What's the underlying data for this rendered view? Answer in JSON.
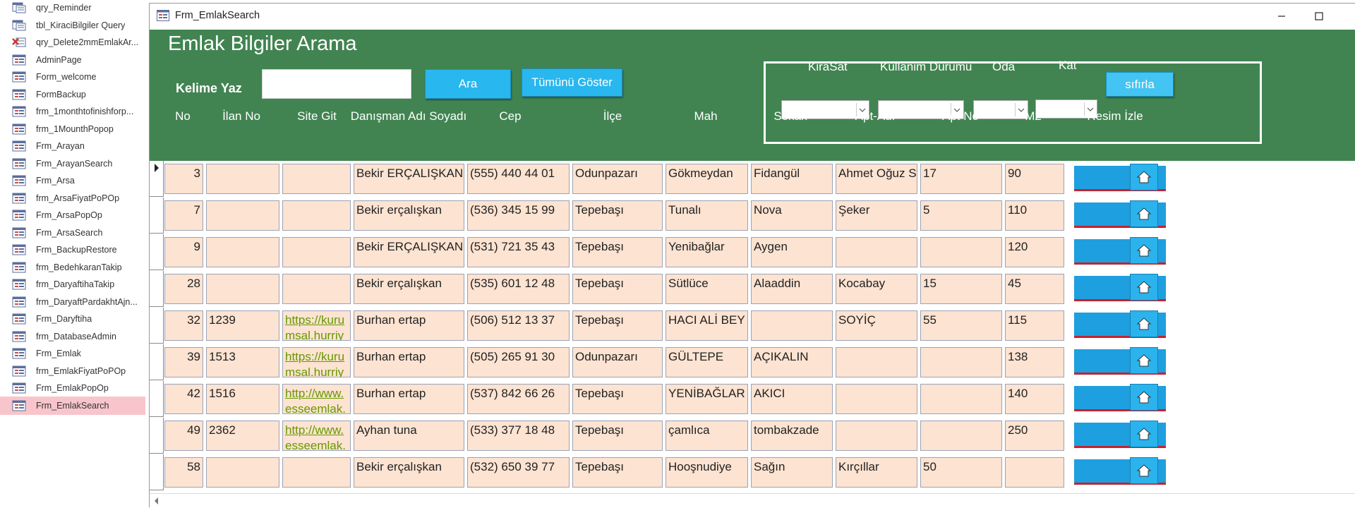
{
  "nav": {
    "items": [
      {
        "label": "qry_Reminder",
        "icon": "query-icon"
      },
      {
        "label": "tbl_KiraciBilgiler Query",
        "icon": "query-icon"
      },
      {
        "label": "qry_Delete2mmEmlakAr...",
        "icon": "delete-query-icon"
      },
      {
        "label": "AdminPage",
        "icon": "form-icon"
      },
      {
        "label": "Form_welcome",
        "icon": "form-icon"
      },
      {
        "label": "FormBackup",
        "icon": "form-icon"
      },
      {
        "label": "frm_1monthtofinishforp...",
        "icon": "form-icon"
      },
      {
        "label": "frm_1MounthPopop",
        "icon": "form-icon"
      },
      {
        "label": "Frm_Arayan",
        "icon": "form-icon"
      },
      {
        "label": "Frm_ArayanSearch",
        "icon": "form-icon"
      },
      {
        "label": "Frm_Arsa",
        "icon": "form-icon"
      },
      {
        "label": "frm_ArsaFiyatPoPOp",
        "icon": "form-icon"
      },
      {
        "label": "Frm_ArsaPopOp",
        "icon": "form-icon"
      },
      {
        "label": "Frm_ArsaSearch",
        "icon": "form-icon"
      },
      {
        "label": "Frm_BackupRestore",
        "icon": "form-icon"
      },
      {
        "label": "frm_BedehkaranTakip",
        "icon": "form-icon"
      },
      {
        "label": "frm_DaryaftihaTakip",
        "icon": "form-icon"
      },
      {
        "label": "frm_DaryaftPardakhtAjn...",
        "icon": "form-icon"
      },
      {
        "label": "Frm_Daryftiha",
        "icon": "form-icon"
      },
      {
        "label": "frm_DatabaseAdmin",
        "icon": "form-icon"
      },
      {
        "label": "Frm_Emlak",
        "icon": "form-icon"
      },
      {
        "label": "frm_EmlakFiyatPoPOp",
        "icon": "form-icon"
      },
      {
        "label": "Frm_EmlakPopOp",
        "icon": "form-icon"
      },
      {
        "label": "Frm_EmlakSearch",
        "icon": "form-icon",
        "selected": true
      }
    ]
  },
  "window": {
    "title": "Frm_EmlakSearch"
  },
  "header": {
    "title": "Emlak Bilgiler Arama",
    "keyword_label": "Kelime Yaz",
    "keyword_value": "",
    "search_button": "Ara",
    "show_all_button": "Tümünü Göster",
    "filters": {
      "kirasat_label": "KiraSat",
      "kullanim_label": "Kullanim Durumu",
      "oda_label": "Oda",
      "kat_label": "Kat",
      "reset_button": "sıfırla"
    }
  },
  "columns": [
    "No",
    "İlan No",
    "Site Git",
    "Danışman Adı Soyadı",
    "Cep",
    "İlçe",
    "Mah",
    "Sokak",
    "Apt-Adı",
    "Apt No",
    "M2",
    "Resim İzle"
  ],
  "rows": [
    {
      "no": "3",
      "ilan": "",
      "site": "",
      "danisman": "Bekir ERÇALIŞKAN",
      "cep": "(555) 440 44 01",
      "ilce": "Odunpazarı",
      "mah": "Gökmeydan",
      "sokak": "Fidangül",
      "apt": "Ahmet Oğuz St.",
      "aptno": "17",
      "m2": "90",
      "current": true
    },
    {
      "no": "7",
      "ilan": "",
      "site": "",
      "danisman": "Bekir erçalışkan",
      "cep": "(536) 345 15 99",
      "ilce": "Tepebaşı",
      "mah": "Tunalı",
      "sokak": "Nova",
      "apt": "Şeker",
      "aptno": "5",
      "m2": "110"
    },
    {
      "no": "9",
      "ilan": "",
      "site": "",
      "danisman": "Bekir ERÇALIŞKAN",
      "cep": "(531) 721 35 43",
      "ilce": "Tepebaşı",
      "mah": "Yenibağlar",
      "sokak": "Aygen",
      "apt": "",
      "aptno": "",
      "m2": "120"
    },
    {
      "no": "28",
      "ilan": "",
      "site": "",
      "danisman": "Bekir erçalışkan",
      "cep": "(535) 601 12 48",
      "ilce": "Tepebaşı",
      "mah": "Sütlüce",
      "sokak": "Alaaddin",
      "apt": "Kocabay",
      "aptno": "15",
      "m2": "45"
    },
    {
      "no": "32",
      "ilan": "1239",
      "site": "https://kurumsal.hurriyeteml",
      "danisman": "Burhan ertap",
      "cep": "(506) 512 13 37",
      "ilce": "Tepebaşı",
      "mah": "HACI ALİ BEY",
      "sokak": "",
      "apt": "SOYİÇ",
      "aptno": "55",
      "m2": "115"
    },
    {
      "no": "39",
      "ilan": "1513",
      "site": "https://kurumsal.hurriyeteml",
      "danisman": "Burhan ertap",
      "cep": "(505) 265 91 30",
      "ilce": "Odunpazarı",
      "mah": "GÜLTEPE",
      "sokak": "AÇIKALIN",
      "apt": "",
      "aptno": "",
      "m2": "138"
    },
    {
      "no": "42",
      "ilan": "1516",
      "site": "http://www.esseemlak.com/",
      "danisman": "Burhan ertap",
      "cep": "(537) 842 66 26",
      "ilce": "Tepebaşı",
      "mah": "YENİBAĞLAR",
      "sokak": "AKICI",
      "apt": "",
      "aptno": "",
      "m2": "140"
    },
    {
      "no": "49",
      "ilan": "2362",
      "site": "http://www.esseemlak.com/i",
      "danisman": "Ayhan tuna",
      "cep": "(533) 377 18 48",
      "ilce": "Tepebaşı",
      "mah": "çamlıca",
      "sokak": "tombakzade",
      "apt": "",
      "aptno": "",
      "m2": "250"
    },
    {
      "no": "58",
      "ilan": "",
      "site": "",
      "danisman": "Bekir erçalışkan",
      "cep": "(532) 650 39 77",
      "ilce": "Tepebaşı",
      "mah": "Hooşnudiye",
      "sokak": "Sağın",
      "apt": "Kırçıllar",
      "aptno": "50",
      "m2": ""
    }
  ],
  "colors": {
    "header_green": "#418451",
    "button_blue": "#28b7ef",
    "cell_fill": "#fde3d1",
    "link_green": "#669900",
    "nav_selected": "#f7c5cb"
  }
}
